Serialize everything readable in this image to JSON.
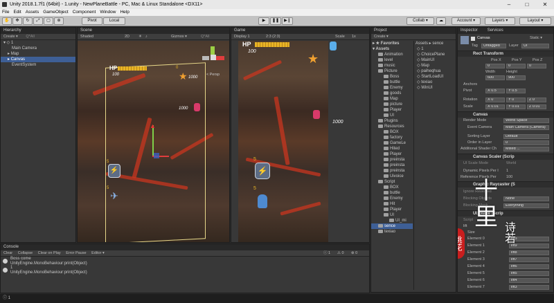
{
  "window": {
    "title": "Unity 2018.1.7f1 (64bit) - 1.unity - NewPlaneBattle - PC, Mac & Linux Standalone <DX11>",
    "minimize": "–",
    "maximize": "□",
    "close": "✕"
  },
  "menu": [
    "File",
    "Edit",
    "Assets",
    "GameObject",
    "Component",
    "Window",
    "Help"
  ],
  "toolbar": {
    "pivot": "Pivot",
    "local": "Local",
    "collab": "Collab ▾",
    "account": "Account ▾",
    "layers": "Layers ▾",
    "layout": "Layout ▾"
  },
  "hierarchy": {
    "tab": "Hierarchy",
    "create": "Create ▾",
    "search": "Q*All",
    "scene": "1",
    "items": [
      "Main Camera",
      "Map",
      "Canvas",
      "EventSystem"
    ]
  },
  "scene": {
    "tab": "Scene",
    "shaded": "Shaded",
    "mode2d": "2D",
    "gizmos": "Gizmos ▾",
    "search": "Q*All",
    "persp": "< Persp",
    "hp": "HP",
    "score": "100",
    "popup": "1000",
    "popup2": "1000",
    "fivea": "5",
    "fiveb": "5",
    "zero": "0"
  },
  "game": {
    "tab": "Game",
    "display": "Display 1",
    "aspect": "2:3 (2:3)",
    "scale": "Scale",
    "scale_val": "1x",
    "hp": "HP",
    "score": "100",
    "popup": "1000",
    "fivea": "5",
    "fiveb": "5",
    "zero": "0"
  },
  "project": {
    "tab": "Project",
    "create": "Create ▾",
    "favorites": "Favorites",
    "assets": "Assets",
    "breadcrumb": "Assets ▸ sence",
    "tree": [
      "Assets",
      "Animation",
      "level",
      "music",
      "Picture",
      "Boss",
      "buttle",
      "Enemy",
      "goods",
      "Map",
      "picture",
      "Player",
      "UI",
      "Plugins",
      "Resources",
      "BOX",
      "factory",
      "GameLe",
      "Hited",
      "Player",
      "preinsta",
      "preinsta",
      "preinsta",
      "Uivoice",
      "Script",
      "BOX",
      "buttle",
      "Enemy",
      "Hit",
      "Player",
      "UI",
      "UI_mi",
      "sence",
      "texiao"
    ],
    "files": [
      "1",
      "ChoicePlane",
      "MainUI",
      "Map",
      "paiheqhua",
      "StartLoadUI",
      "texiao",
      "WinUI"
    ]
  },
  "inspector": {
    "tab": "Inspector",
    "services": "Services",
    "object": "Canvas",
    "static": "Static ▾",
    "tag_label": "Tag",
    "tag": "Untagged",
    "layer_label": "Layer",
    "layer": "UI",
    "rect": "Rect Transform",
    "posx": "Pos X",
    "posy": "Pos Y",
    "posz": "Pos Z",
    "px": "0",
    "py": "0",
    "pz": "0",
    "width_l": "Width",
    "height_l": "Height",
    "w": "600",
    "h": "900",
    "anchors": "Anchors",
    "pivot": "Pivot",
    "pivx": "X 0.5",
    "pivy": "Y 0.5",
    "rotation": "Rotation",
    "rx": "X 0",
    "ry": "Y 0",
    "rz": "Z 0",
    "scale": "Scale",
    "sx": "X 0.01",
    "sy": "Y 0.01",
    "sz": "Z 0.01",
    "canvas": "Canvas",
    "render_mode_l": "Render Mode",
    "render_mode": "World Space",
    "event_cam_l": "Event Camera",
    "event_cam": "Main Camera (Camera)",
    "sorting_l": "Sorting Layer",
    "sorting": "Default",
    "order_l": "Order in Layer",
    "order": "0",
    "shader_l": "Additional Shader Ch",
    "shader": "Mixed ...",
    "scaler": "Canvas Scaler (Scrip",
    "ui_scale_l": "UI Scale Mode",
    "ui_scale": "World",
    "dyn_l": "Dynamic Pixels Per I",
    "dyn": "1",
    "ref_l": "Reference Pixels Per",
    "ref": "100",
    "raycaster": "Graphic Raycaster (S",
    "ignore_l": "Ignore Reversed",
    "block_obj_l": "Blocking Objects",
    "block_obj": "None",
    "block_mask_l": "Blocking Mask",
    "block_mask": "Everything",
    "uiplane": "UI_plane (Scrip",
    "script_l": "Script",
    "lift": "lift",
    "size_l": "Size",
    "elements": [
      {
        "l": "Element 0",
        "v": "lift3"
      },
      {
        "l": "Element 1",
        "v": "lift9"
      },
      {
        "l": "Element 2",
        "v": "lift8"
      },
      {
        "l": "Element 3",
        "v": "lift7"
      },
      {
        "l": "Element 4",
        "v": "lift6"
      },
      {
        "l": "Element 5",
        "v": "lift5"
      },
      {
        "l": "Element 6",
        "v": "lift4"
      },
      {
        "l": "Element 7",
        "v": "lift3"
      }
    ]
  },
  "watermark": {
    "a": "十",
    "b": "里",
    "seal": "桃花",
    "sig": "诗若"
  },
  "console": {
    "tab": "Console",
    "clear": "Clear",
    "collapse": "Collapse",
    "clear_play": "Clear on Play",
    "error_pause": "Error Pause",
    "editor": "Editor ▾",
    "counts": [
      "1",
      "0",
      "0"
    ],
    "logs": [
      [
        "Boss come",
        "UnityEngine.MonoBehaviour:print(Object)"
      ],
      [
        "1",
        "UnityEngine.MonoBehaviour:print(Object)"
      ]
    ]
  },
  "status": "1",
  "colors": {
    "selection": "#3e5f96",
    "hp_bar": "#e8b425",
    "lava": "#c8351f"
  }
}
